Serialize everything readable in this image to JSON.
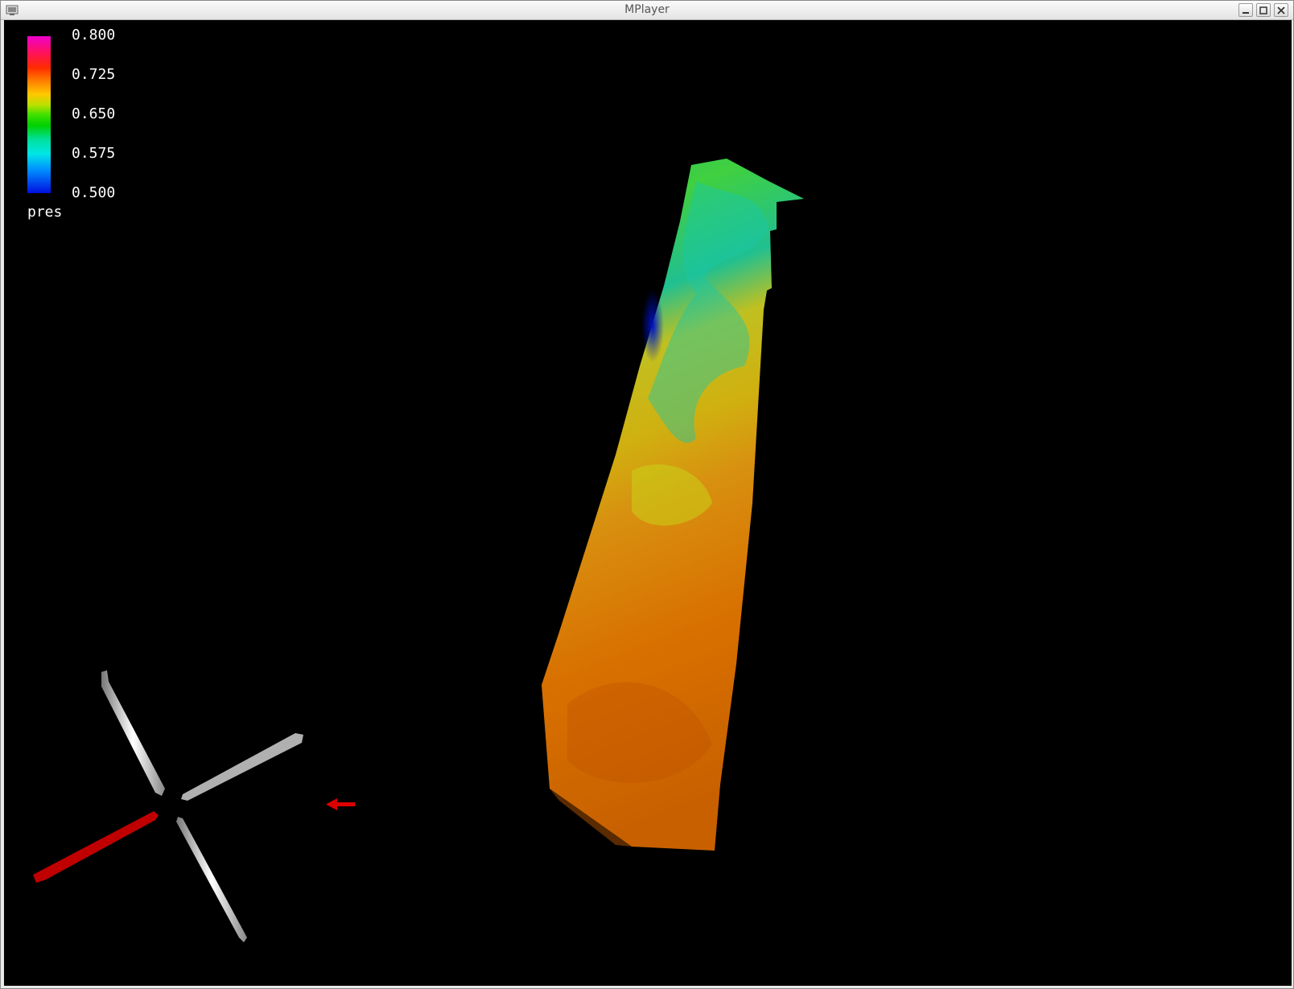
{
  "window": {
    "title": "MPlayer"
  },
  "legend": {
    "ticks": [
      "0.800",
      "0.725",
      "0.650",
      "0.575",
      "0.500"
    ],
    "variable": "pres",
    "colors": {
      "max": "#ee00cc",
      "high": "#ff2a00",
      "mid": "#40e000",
      "low": "#00e6e6",
      "min": "#0010e0"
    }
  },
  "scene": {
    "axis_colors": {
      "x": "#cc0000",
      "y": "#e0e0e0",
      "z": "#bbbbbb"
    },
    "arrow_color": "#dd0000"
  }
}
